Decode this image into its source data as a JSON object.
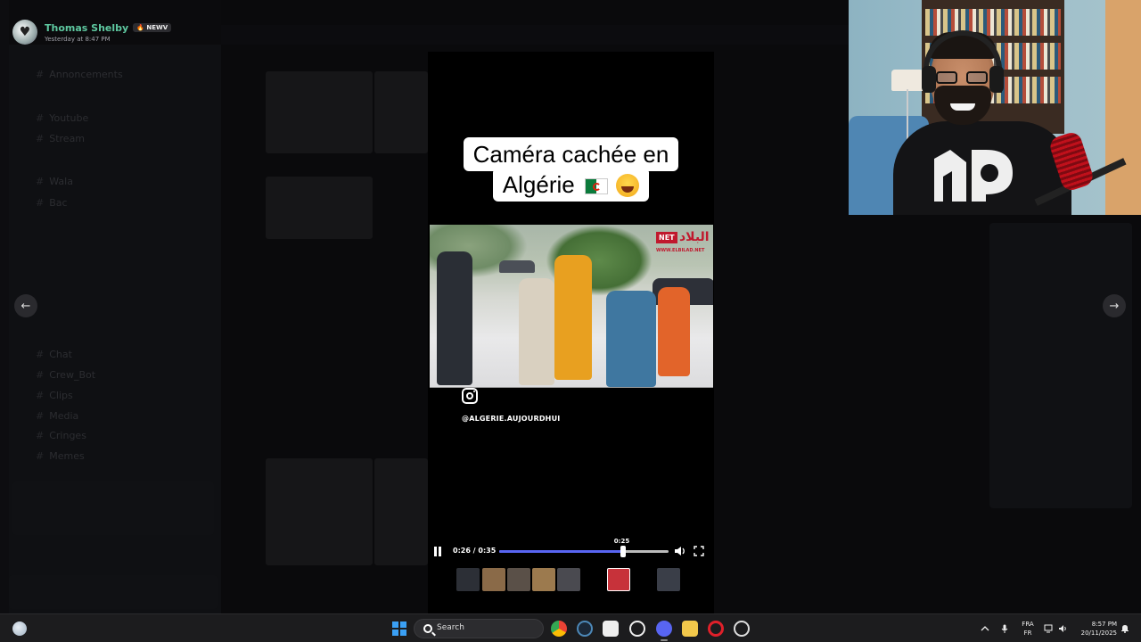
{
  "user": {
    "name": "Thomas Shelby",
    "badge": "NEWV",
    "timestamp": "Yesterday at 8:47 PM"
  },
  "video": {
    "caption_line1": "Caméra cachée en",
    "caption_line2": "Algérie",
    "source_logo": "NET",
    "source_logo_arabic": "البلاد",
    "source_url": "WWW.ELBILAD.NET",
    "handle": "@ALGERIE.AUJOURDHUI",
    "current_time": "0:26 / 0:35",
    "hover_time": "0:25",
    "progress_fraction": 0.73,
    "hover_fraction": 0.72
  },
  "background_channels": [
    "Annoncements",
    "Youtube",
    "Stream",
    "Wala",
    "Bac",
    "Chat",
    "Crew_Bot",
    "Clips",
    "Media",
    "Cringes",
    "Memes"
  ],
  "taskbar": {
    "search_placeholder": "Search",
    "language_top": "FRA",
    "language_bottom": "FR",
    "time": "8:57 PM",
    "date": "20/11/2025",
    "apps": [
      "chrome-icon",
      "steam-icon",
      "store-icon",
      "chatgpt-icon",
      "discord-icon",
      "file-explorer-icon",
      "opera-icon",
      "app-icon"
    ]
  },
  "colors": {
    "accent_progress": "#5865f2",
    "username": "#5ec8a0"
  }
}
